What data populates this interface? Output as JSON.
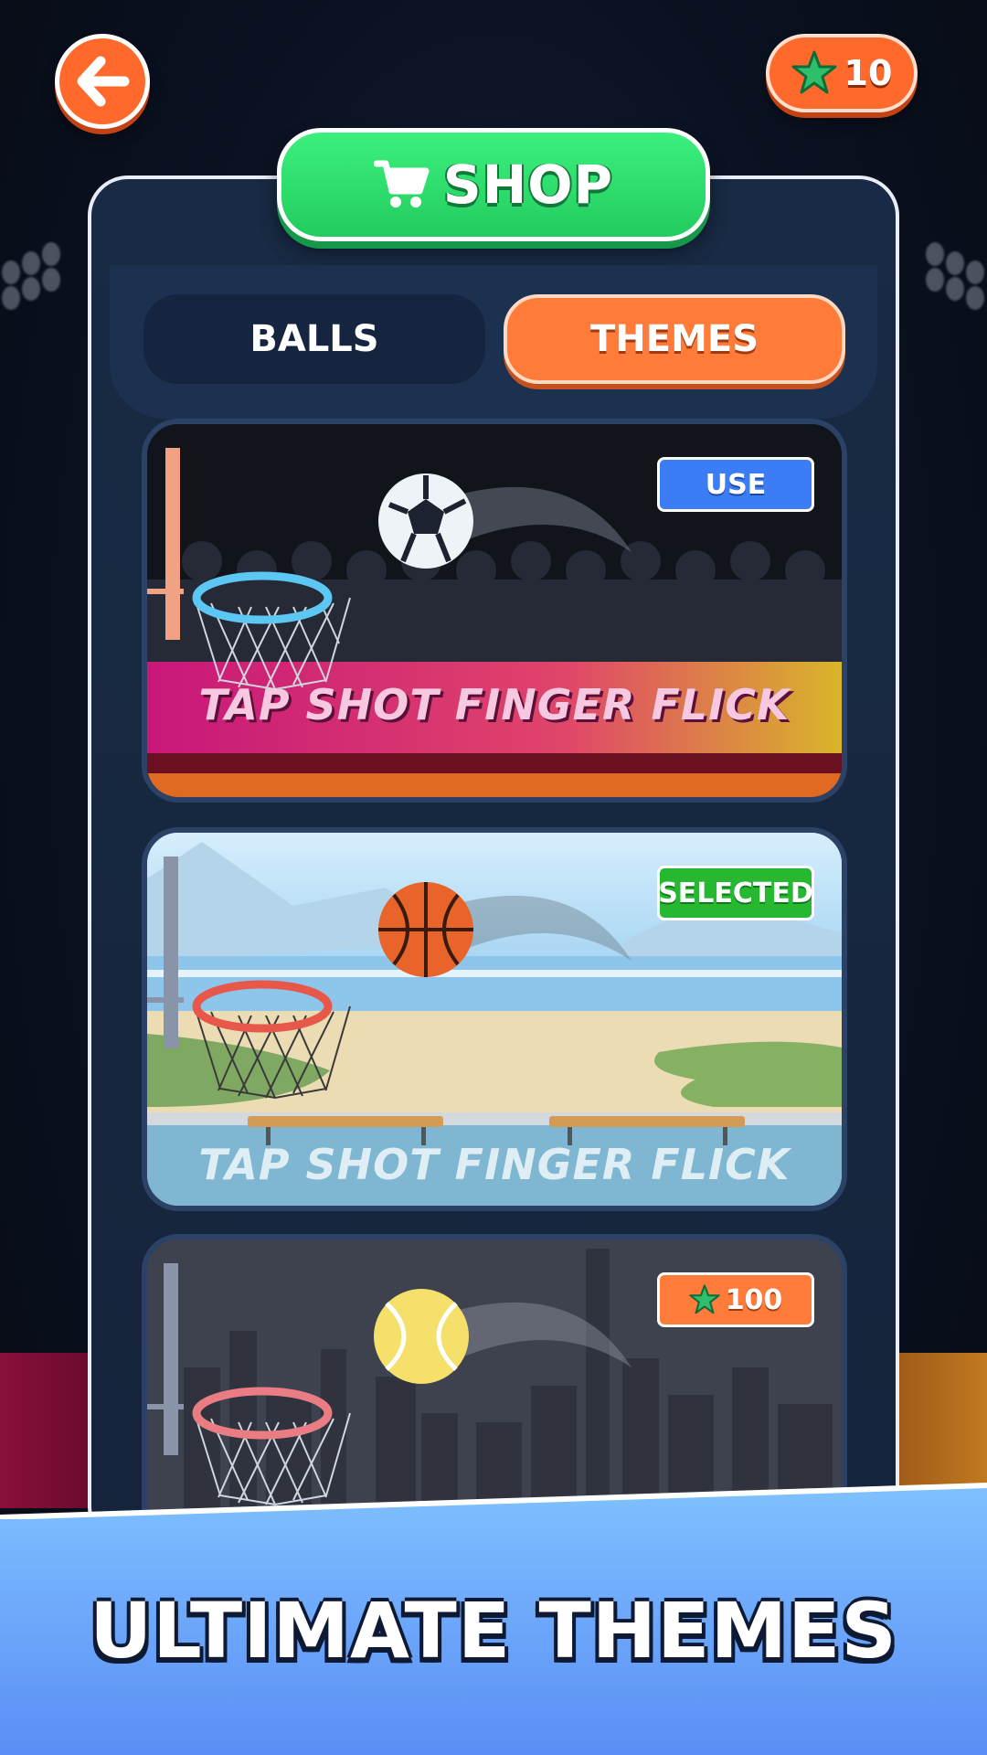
{
  "header": {
    "back_icon": "arrow-left-icon",
    "star_icon": "star-icon",
    "star_count": "10"
  },
  "shop": {
    "title": "SHOP",
    "cart_icon": "cart-icon"
  },
  "tabs": [
    {
      "label": "BALLS",
      "active": false
    },
    {
      "label": "THEMES",
      "active": true
    }
  ],
  "themes": [
    {
      "status": "USE",
      "ball": "soccer-ball",
      "watermark": "TAP SHOT FINGER FLICK"
    },
    {
      "status": "SELECTED",
      "ball": "basketball",
      "watermark": "TAP SHOT FINGER FLICK"
    },
    {
      "status": "100",
      "ball": "tennis-ball",
      "price_icon": "star-icon"
    }
  ],
  "footer": {
    "tagline": "ULTIMATE THEMES"
  },
  "colors": {
    "accent_orange": "#ff6a2c",
    "shop_green": "#27d466",
    "use_blue": "#3c7cf5",
    "selected_green": "#27b832",
    "panel_navy": "#182a44"
  }
}
